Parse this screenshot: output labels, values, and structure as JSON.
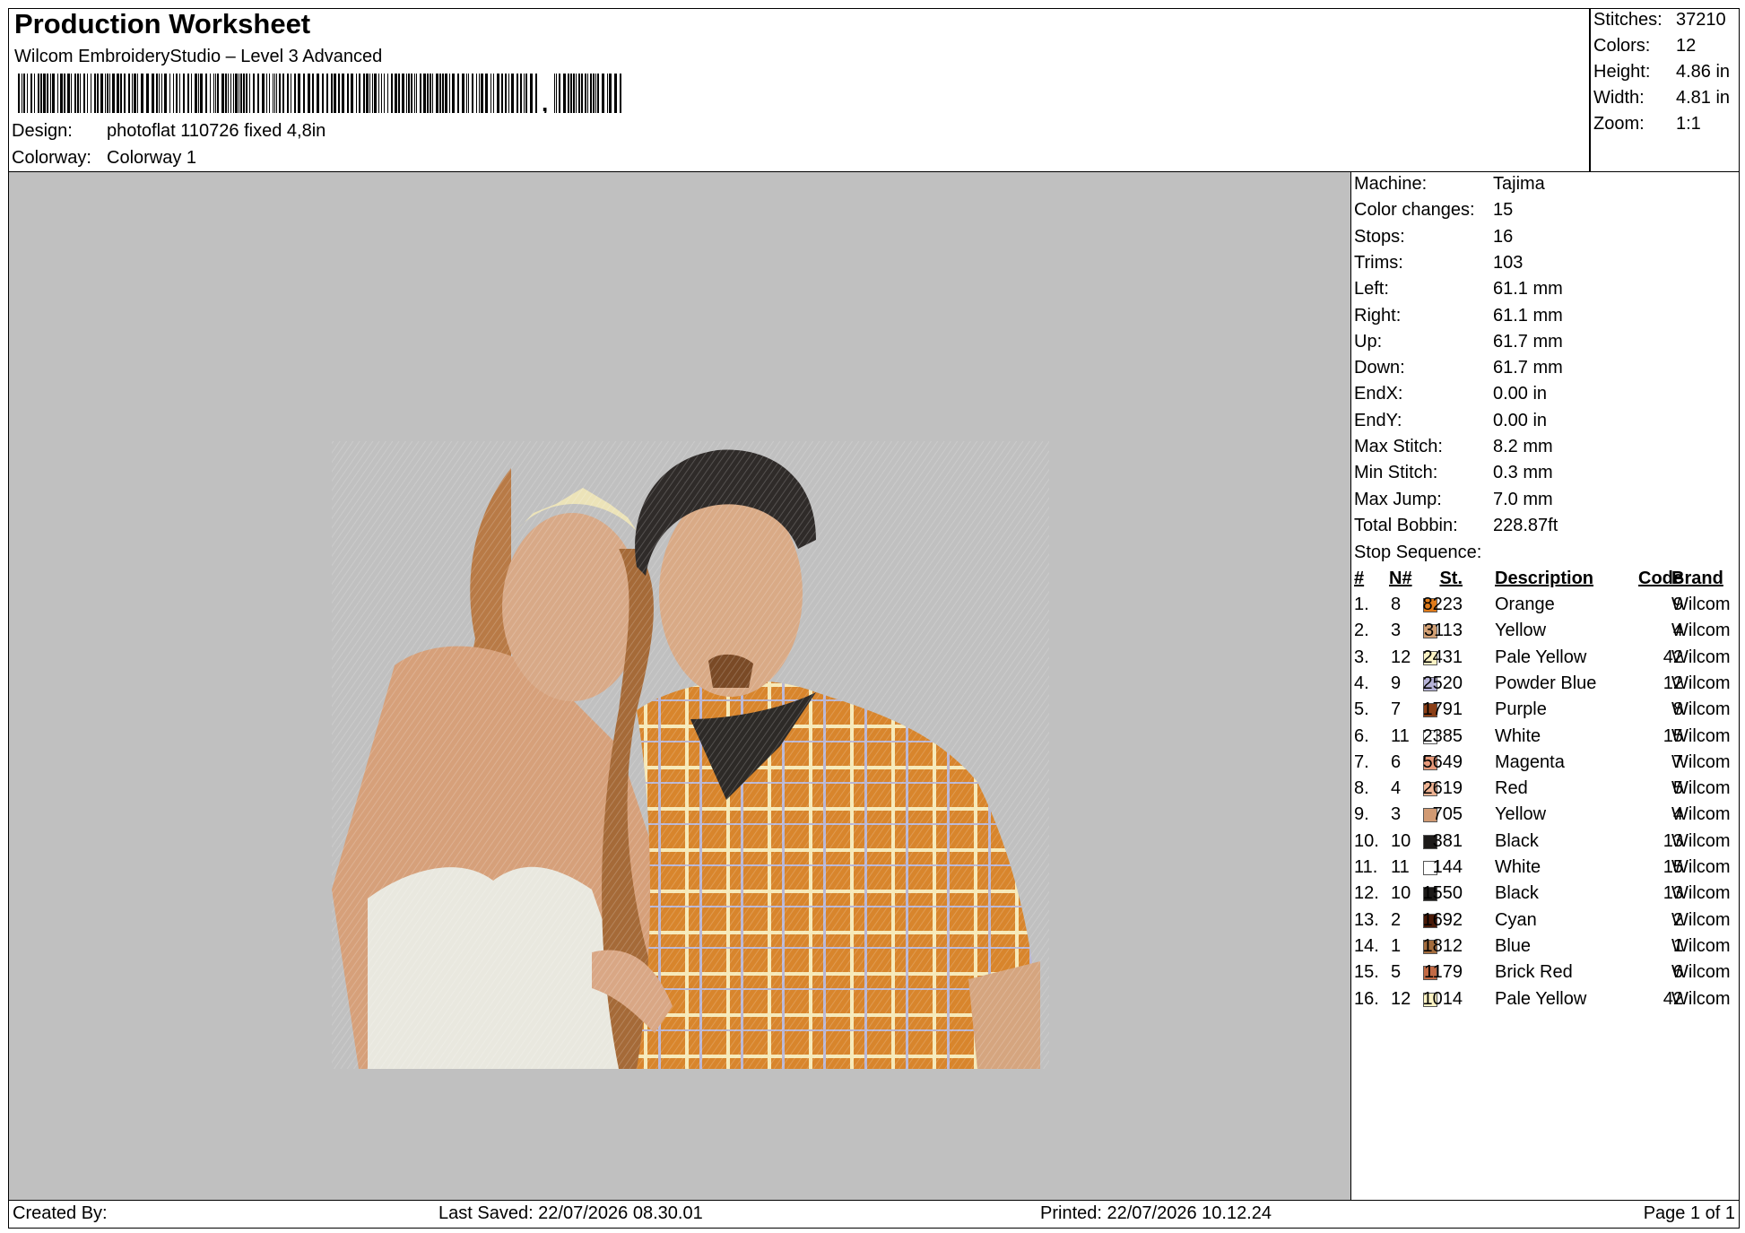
{
  "header": {
    "title": "Production Worksheet",
    "subtitle": "Wilcom EmbroideryStudio – Level 3 Advanced",
    "design_label": "Design:",
    "design_value": "photoflat 110726 fixed 4,8in",
    "colorway_label": "Colorway:",
    "colorway_value": "Colorway 1"
  },
  "stats": [
    {
      "label": "Stitches:",
      "value": "37210"
    },
    {
      "label": "Colors:",
      "value": "12"
    },
    {
      "label": "Height:",
      "value": "4.86 in"
    },
    {
      "label": "Width:",
      "value": "4.81 in"
    },
    {
      "label": "Zoom:",
      "value": "1:1"
    }
  ],
  "machine_info": [
    {
      "label": "Machine:",
      "value": "Tajima"
    },
    {
      "label": "Color changes:",
      "value": "15"
    },
    {
      "label": "Stops:",
      "value": "16"
    },
    {
      "label": "Trims:",
      "value": "103"
    },
    {
      "label": "Left:",
      "value": "61.1 mm"
    },
    {
      "label": "Right:",
      "value": "61.1 mm"
    },
    {
      "label": "Up:",
      "value": "61.7 mm"
    },
    {
      "label": "Down:",
      "value": "61.7 mm"
    },
    {
      "label": "EndX:",
      "value": "0.00 in"
    },
    {
      "label": "EndY:",
      "value": "0.00 in"
    },
    {
      "label": "Max Stitch:",
      "value": "8.2 mm"
    },
    {
      "label": "Min Stitch:",
      "value": "0.3 mm"
    },
    {
      "label": "Max Jump:",
      "value": "7.0 mm"
    },
    {
      "label": "Total Bobbin:",
      "value": "228.87ft"
    }
  ],
  "stop_sequence": {
    "label": "Stop Sequence:",
    "headers": {
      "num": "#",
      "n": "N#",
      "st": "St.",
      "description": "Description",
      "code": "Code",
      "brand": "Brand"
    },
    "rows": [
      {
        "num": "1.",
        "n": "8",
        "color": "#e07b1a",
        "st": "8223",
        "description": "Orange",
        "code": "9",
        "brand": "Wilcom"
      },
      {
        "num": "2.",
        "n": "3",
        "color": "#d2a074",
        "st": "3113",
        "description": "Yellow",
        "code": "4",
        "brand": "Wilcom"
      },
      {
        "num": "3.",
        "n": "12",
        "color": "#fbf3c4",
        "st": "2431",
        "description": "Pale Yellow",
        "code": "42",
        "brand": "Wilcom"
      },
      {
        "num": "4.",
        "n": "9",
        "color": "#b7b3d8",
        "st": "2520",
        "description": "Powder Blue",
        "code": "12",
        "brand": "Wilcom"
      },
      {
        "num": "5.",
        "n": "7",
        "color": "#8b3f17",
        "st": "1791",
        "description": "Purple",
        "code": "8",
        "brand": "Wilcom"
      },
      {
        "num": "6.",
        "n": "11",
        "color": "#ffffff",
        "st": "2385",
        "description": "White",
        "code": "15",
        "brand": "Wilcom"
      },
      {
        "num": "7.",
        "n": "6",
        "color": "#e6997a",
        "st": "5649",
        "description": "Magenta",
        "code": "7",
        "brand": "Wilcom"
      },
      {
        "num": "8.",
        "n": "4",
        "color": "#eeb393",
        "st": "2619",
        "description": "Red",
        "code": "5",
        "brand": "Wilcom"
      },
      {
        "num": "9.",
        "n": "3",
        "color": "#d19a73",
        "st": "705",
        "description": "Yellow",
        "code": "4",
        "brand": "Wilcom"
      },
      {
        "num": "10.",
        "n": "10",
        "color": "#1c1a19",
        "st": "381",
        "description": "Black",
        "code": "13",
        "brand": "Wilcom"
      },
      {
        "num": "11.",
        "n": "11",
        "color": "#ffffff",
        "st": "144",
        "description": "White",
        "code": "15",
        "brand": "Wilcom"
      },
      {
        "num": "12.",
        "n": "10",
        "color": "#1c1a19",
        "st": "1550",
        "description": "Black",
        "code": "13",
        "brand": "Wilcom"
      },
      {
        "num": "13.",
        "n": "2",
        "color": "#4a1a08",
        "st": "1692",
        "description": "Cyan",
        "code": "2",
        "brand": "Wilcom"
      },
      {
        "num": "14.",
        "n": "1",
        "color": "#a46c3c",
        "st": "1812",
        "description": "Blue",
        "code": "1",
        "brand": "Wilcom"
      },
      {
        "num": "15.",
        "n": "5",
        "color": "#c26a45",
        "st": "1179",
        "description": "Brick Red",
        "code": "6",
        "brand": "Wilcom"
      },
      {
        "num": "16.",
        "n": "12",
        "color": "#fbf3c4",
        "st": "1014",
        "description": "Pale Yellow",
        "code": "42",
        "brand": "Wilcom"
      }
    ]
  },
  "footer": {
    "created_by": "Created By:",
    "last_saved": "Last Saved: 22/07/2026 08.30.01",
    "printed": "Printed: 22/07/2026 10.12.24",
    "page": "Page 1 of 1"
  }
}
